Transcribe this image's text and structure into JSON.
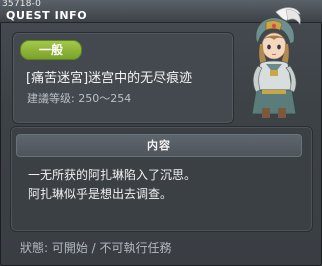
{
  "window": {
    "quest_id": "35718-0",
    "title": "QUEST INFO"
  },
  "quest": {
    "badge": "一般",
    "name": "[痛苦迷宮]迷宫中的无尽痕迹",
    "level": "建議等级: 250～254"
  },
  "content": {
    "header": "内容",
    "lines": [
      "一无所获的阿扎琳陷入了沉思。",
      "阿扎琳似乎是想出去调查。"
    ]
  },
  "status": "狀態: 可開始 / 不可執行任務",
  "colors": {
    "badge_green": "#8ab535",
    "panel_bg": "#43494f",
    "window_bg": "#3d4247"
  },
  "icons": {
    "portrait": "npc-portrait-icon"
  }
}
